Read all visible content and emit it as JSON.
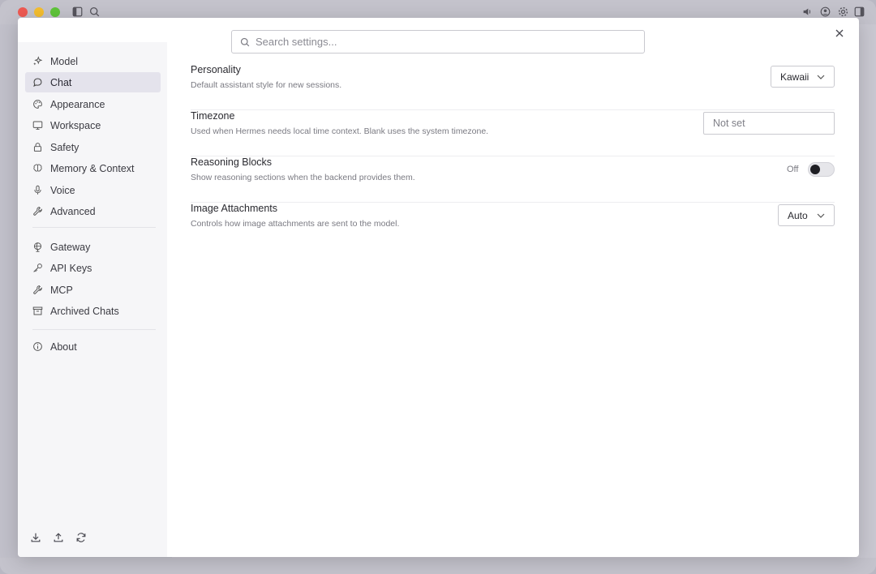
{
  "search": {
    "placeholder": "Search settings..."
  },
  "sidebar": {
    "groups": [
      [
        {
          "label": "Model",
          "icon": "sparkles-icon"
        },
        {
          "label": "Chat",
          "icon": "chat-bubble-icon",
          "active": true
        },
        {
          "label": "Appearance",
          "icon": "palette-icon"
        },
        {
          "label": "Workspace",
          "icon": "monitor-icon"
        },
        {
          "label": "Safety",
          "icon": "lock-icon"
        },
        {
          "label": "Memory & Context",
          "icon": "brain-icon"
        },
        {
          "label": "Voice",
          "icon": "microphone-icon"
        },
        {
          "label": "Advanced",
          "icon": "wrench-icon"
        }
      ],
      [
        {
          "label": "Gateway",
          "icon": "globe-icon"
        },
        {
          "label": "API Keys",
          "icon": "key-icon"
        },
        {
          "label": "MCP",
          "icon": "wrench-icon"
        },
        {
          "label": "Archived Chats",
          "icon": "archive-icon"
        }
      ],
      [
        {
          "label": "About",
          "icon": "info-icon"
        }
      ]
    ],
    "footer_icons": [
      "download-icon",
      "upload-icon",
      "refresh-icon"
    ]
  },
  "settings": {
    "personality": {
      "title": "Personality",
      "description": "Default assistant style for new sessions.",
      "value": "Kawaii"
    },
    "timezone": {
      "title": "Timezone",
      "description": "Used when Hermes needs local time context. Blank uses the system timezone.",
      "placeholder": "Not set"
    },
    "reasoning_blocks": {
      "title": "Reasoning Blocks",
      "description": "Show reasoning sections when the backend provides them.",
      "state_label": "Off"
    },
    "image_attachments": {
      "title": "Image Attachments",
      "description": "Controls how image attachments are sent to the model.",
      "value": "Auto"
    }
  },
  "colors": {
    "active_nav_bg": "#e4e3ec",
    "sidebar_bg": "#f6f6f8",
    "toggle_knob": "#1f1f24"
  }
}
